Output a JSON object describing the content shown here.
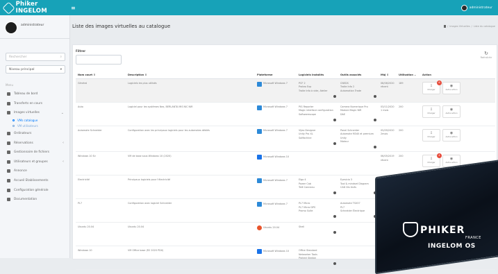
{
  "header": {
    "brand": "Phiker INGELOM",
    "menu_icon": "hamburger-icon",
    "user": "administrateur"
  },
  "sidebar": {
    "user_name": "administrateur",
    "search_placeholder": "Rechercher",
    "scope_select": "Niveau principal",
    "section_label": "Menu",
    "items": [
      {
        "label": "Tableau de bord",
        "icon": "dashboard-icon"
      },
      {
        "label": "Transferts en cours",
        "icon": "transfer-icon"
      },
      {
        "label": "Images virtuelles",
        "icon": "images-icon",
        "children": [
          "VMs catalogue",
          "VM utilisateurs"
        ]
      },
      {
        "label": "Ordinateurs",
        "icon": "desktop-icon"
      },
      {
        "label": "Réservations",
        "icon": "calendar-icon"
      },
      {
        "label": "Gestionnaire de fichiers",
        "icon": "folder-icon"
      },
      {
        "label": "Utilisateurs et groupes",
        "icon": "users-icon"
      },
      {
        "label": "Annonce",
        "icon": "megaphone-icon"
      },
      {
        "label": "Accueil Etablissements",
        "icon": "building-icon"
      },
      {
        "label": "Configuration générale",
        "icon": "gear-icon"
      },
      {
        "label": "Documentation",
        "icon": "book-icon"
      }
    ]
  },
  "main": {
    "title": "Liste des images virtuelles au catalogue",
    "breadcrumb": [
      "Images Virtuelles",
      "Liste du catalogue"
    ],
    "filter_label": "Filtrer",
    "refresh_label": "Rafraîchir",
    "columns": [
      "Nom court ⇕",
      "Description ⇕",
      "Plateforme",
      "Logiciels installés",
      "Outils associés",
      "MàJ ⇕",
      "Utilisation ⌄",
      "Action"
    ],
    "rows": [
      {
        "name": "Général",
        "description": "Logiciels les plus utilisés",
        "platform": "Microsoft Windows 7",
        "os": "windows7",
        "software": "PCF 2\nProteo Exp\nTraite Info à vide, Atelier",
        "tools": "CNEDS\nTraite Info 2\nAutomation Trade",
        "updated": "08/06/2020\nrécent",
        "usage": "189",
        "badge": "6"
      },
      {
        "name": "Auto",
        "description": "Logiciel pour les systèmes Nex, BERLANTA MIS NIC NIR",
        "platform": "Microsoft Windows 7",
        "os": "windows7",
        "software": "PIG Reporter\nMagic interface configuration\nSoftwarescope",
        "tools": "Camera Numerique Pro\nModule Magic NIR\nDAE",
        "updated": "03/11/2020\n1 mois",
        "usage": "200",
        "badge": ""
      },
      {
        "name": "Automate Schneider",
        "description": "Configuration avec les principaux logiciels pour les automates dédiés",
        "platform": "Microsoft Windows 7",
        "os": "windows7",
        "software": "Vijeo Designer\nUnity Pro XL\nSoMachine",
        "tools": "Panel Schneider\nAutomate M340 et premium\nUnity\nMoteur",
        "updated": "05/09/2020\n2mois",
        "usage": "200",
        "badge": ""
      },
      {
        "name": "Windows 10 Ev",
        "description": "VM de base sous Windows 10 (2020)",
        "platform": "Microsoft Windows 10",
        "os": "windows10",
        "software": "",
        "tools": "",
        "updated": "06/05/2019\nrécent",
        "usage": "200",
        "badge": "4"
      },
      {
        "name": "Electricité",
        "description": "Principaux logiciels pour l'électricité",
        "platform": "Microsoft Windows 7",
        "os": "windows7",
        "software": "Elgo 4\nPower Cab\nTelé Canneau",
        "tools": "Eyesicio 3\nTool & mindset Diagram\nCAD Dis tinés",
        "updated": "08/08/2020\nrécent",
        "usage": "",
        "badge": ""
      },
      {
        "name": "PL7",
        "description": "Configuration avec logiciel Schneider",
        "platform": "Microsoft Windows 7",
        "os": "windows7",
        "software": "PL7 Micro\nPL7 Micro DPS\nPromo Suite",
        "tools": "Automate TSX37\nPL7\nSchneider Électrique",
        "updated": "",
        "usage": "",
        "badge": ""
      },
      {
        "name": "Ubuntu 20.04",
        "description": "Ubuntu 20.04",
        "platform": "Ubuntu 20.04",
        "os": "ubuntu",
        "software": "Shell",
        "tools": "",
        "updated": "",
        "usage": "",
        "badge": ""
      },
      {
        "name": "Windows 10",
        "description": "VM Office base (R2 2020 PDX)",
        "platform": "Microsoft Windows 10",
        "os": "windows10",
        "software": "Office Standard\nNetworker Tools\nProtect Station",
        "tools": "",
        "updated": "",
        "usage": "",
        "badge": ""
      }
    ],
    "action_labels": {
      "download": "Charger",
      "more": "Autre action"
    }
  },
  "overlay": {
    "word": "PHIKER",
    "sub": "FRANCE",
    "product": "INGELOM OS"
  }
}
